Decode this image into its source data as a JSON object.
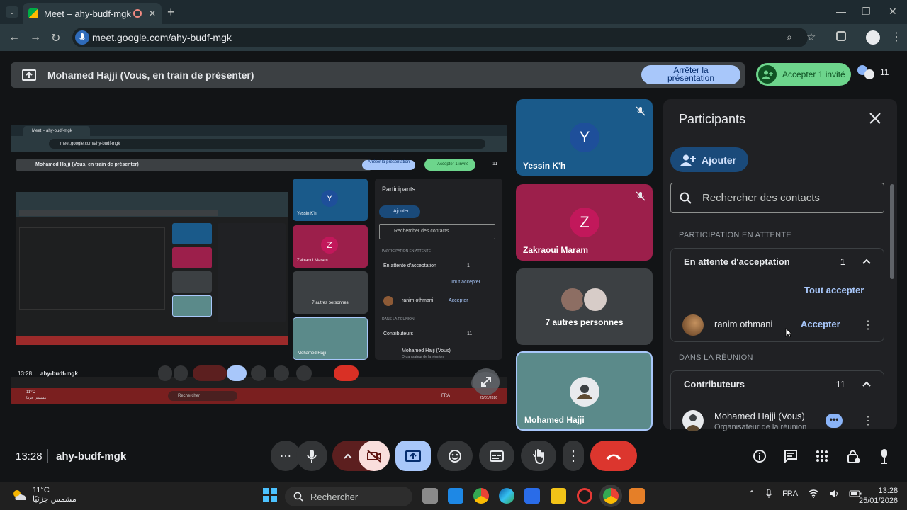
{
  "browser": {
    "tab_title": "Meet – ahy-budf-mgk",
    "url": "meet.google.com/ahy-budf-mgk"
  },
  "banner": {
    "title": "Mohamed Hajji (Vous, en train de présenter)",
    "stop_label_1": "Arrêter la",
    "stop_label_2": "présentation",
    "accept_label": "Accepter 1 invité",
    "people_count": "11"
  },
  "tiles": [
    {
      "name": "Yessin K'h",
      "initial": "Y",
      "color": "#1a5a8a",
      "avatar_color": "#1e4f9a"
    },
    {
      "name": "Zakraoui Maram",
      "initial": "Z",
      "color": "#9c1f4b",
      "avatar_color": "#c2185b"
    },
    {
      "name": "7 autres personnes",
      "color": "#3c4043"
    },
    {
      "name": "Mohamed Hajji",
      "color": "#5b8a8a"
    }
  ],
  "panel": {
    "title": "Participants",
    "add_label": "Ajouter",
    "search_placeholder": "Rechercher des contacts",
    "waiting_section": "PARTICIPATION EN ATTENTE",
    "waiting_group": "En attente d'acceptation",
    "waiting_count": "1",
    "accept_all": "Tout accepter",
    "waiting_person": "ranim othmani",
    "accept": "Accepter",
    "in_meeting_section": "DANS LA RÉUNION",
    "contributors_group": "Contributeurs",
    "contributors_count": "11",
    "member_name": "Mohamed Hajji (Vous)",
    "member_role": "Organisateur de la réunion"
  },
  "footer": {
    "time": "13:28",
    "meeting_code": "ahy-budf-mgk"
  },
  "preview": {
    "tab_title": "Meet – ahy-budf-mgk",
    "url": "meet.google.com/ahy-budf-mgk",
    "banner_title": "Mohamed Hajji (Vous, en train de présenter)",
    "stop_label": "Arrêter la présentation",
    "accept_label": "Accepter 1 invité",
    "people_count": "11",
    "yessin": "Yessin K'h",
    "zakraoui": "Zakraoui Maram",
    "others": "7 autres personnes",
    "mohamed": "Mohamed Hajji",
    "panel_title": "Participants",
    "add": "Ajouter",
    "search": "Rechercher des contacts",
    "waiting_section": "PARTICIPATION EN ATTENTE",
    "waiting_group": "En attente d'acceptation",
    "waiting_count": "1",
    "accept_all": "Tout accepter",
    "waiting_person": "ranim othmani",
    "accept": "Accepter",
    "in_meeting": "DANS LA RÉUNION",
    "contributors": "Contributeurs",
    "contributors_count": "11",
    "member": "Mohamed Hajji (Vous)",
    "member_role": "Organisateur de la réunion",
    "time": "13:28",
    "code": "ahy-budf-mgk",
    "temp": "11°C",
    "weather_desc": "مشمس جزئيًا",
    "tb_search": "Rechercher",
    "lang": "FRA",
    "date": "25/01/2026"
  },
  "taskbar": {
    "temperature": "11°C",
    "weather_desc": "مشمس جزئيًا",
    "search_label": "Rechercher",
    "language": "FRA",
    "time": "13:28",
    "date": "25/01/2026"
  }
}
